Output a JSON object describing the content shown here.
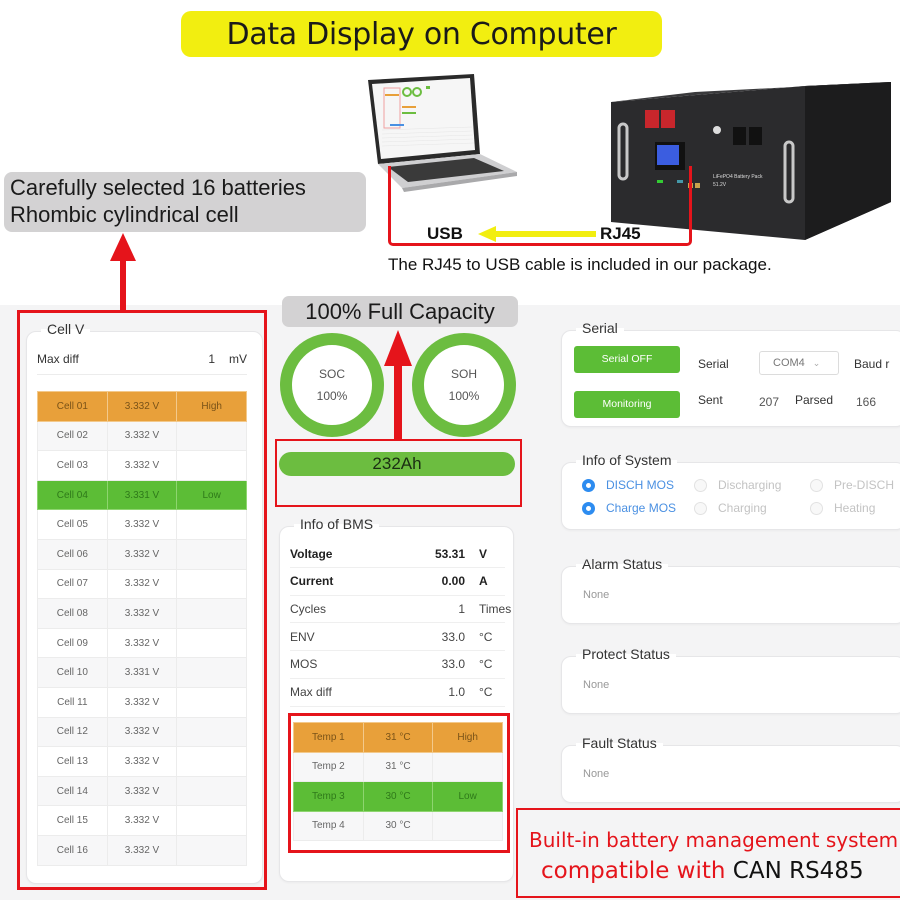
{
  "header": {
    "title": "Data Display on Computer",
    "usb_label": "USB",
    "rj45_label": "RJ45",
    "cable_note": "The RJ45 to USB cable is included in our package.",
    "battery_label": "LiFePO4 Battery Pack",
    "battery_voltage": "51.2V"
  },
  "callouts": {
    "cells_line1": "Carefully selected 16 batteries",
    "cells_line2": "Rhombic cylindrical cell",
    "capacity": "100% Full Capacity",
    "bms_line1": "Built-in battery management system",
    "bms_line2_prefix": "compatible with ",
    "bms_line2_highlight": "CAN RS485"
  },
  "cell_v": {
    "legend": "Cell V",
    "max_diff_label": "Max diff",
    "max_diff_value": "1",
    "max_diff_unit": "mV",
    "rows": [
      {
        "name": "Cell 01",
        "voltage": "3.332 V",
        "flag": "High",
        "state": "high"
      },
      {
        "name": "Cell 02",
        "voltage": "3.332 V",
        "flag": "",
        "state": ""
      },
      {
        "name": "Cell 03",
        "voltage": "3.332 V",
        "flag": "",
        "state": ""
      },
      {
        "name": "Cell 04",
        "voltage": "3.331 V",
        "flag": "Low",
        "state": "low"
      },
      {
        "name": "Cell 05",
        "voltage": "3.332 V",
        "flag": "",
        "state": ""
      },
      {
        "name": "Cell 06",
        "voltage": "3.332 V",
        "flag": "",
        "state": ""
      },
      {
        "name": "Cell 07",
        "voltage": "3.332 V",
        "flag": "",
        "state": ""
      },
      {
        "name": "Cell 08",
        "voltage": "3.332 V",
        "flag": "",
        "state": ""
      },
      {
        "name": "Cell 09",
        "voltage": "3.332 V",
        "flag": "",
        "state": ""
      },
      {
        "name": "Cell 10",
        "voltage": "3.331 V",
        "flag": "",
        "state": ""
      },
      {
        "name": "Cell 11",
        "voltage": "3.332 V",
        "flag": "",
        "state": ""
      },
      {
        "name": "Cell 12",
        "voltage": "3.332 V",
        "flag": "",
        "state": ""
      },
      {
        "name": "Cell 13",
        "voltage": "3.332 V",
        "flag": "",
        "state": ""
      },
      {
        "name": "Cell 14",
        "voltage": "3.332 V",
        "flag": "",
        "state": ""
      },
      {
        "name": "Cell 15",
        "voltage": "3.332 V",
        "flag": "",
        "state": ""
      },
      {
        "name": "Cell 16",
        "voltage": "3.332 V",
        "flag": "",
        "state": ""
      }
    ]
  },
  "gauges": {
    "soc_label": "SOC",
    "soc_value": "100%",
    "soh_label": "SOH",
    "soh_value": "100%",
    "capacity": "232Ah"
  },
  "bms": {
    "legend": "Info of BMS",
    "rows": [
      {
        "key": "Voltage",
        "value": "53.31",
        "unit": "V",
        "bold": true
      },
      {
        "key": "Current",
        "value": "0.00",
        "unit": "A",
        "bold": true
      },
      {
        "key": "Cycles",
        "value": "1",
        "unit": "Times",
        "bold": false
      },
      {
        "key": "ENV",
        "value": "33.0",
        "unit": "°C",
        "bold": false
      },
      {
        "key": "MOS",
        "value": "33.0",
        "unit": "°C",
        "bold": false
      },
      {
        "key": "Max diff",
        "value": "1.0",
        "unit": "°C",
        "bold": false
      }
    ],
    "temps": [
      {
        "name": "Temp 1",
        "value": "31 °C",
        "flag": "High",
        "state": "high"
      },
      {
        "name": "Temp 2",
        "value": "31 °C",
        "flag": "",
        "state": ""
      },
      {
        "name": "Temp 3",
        "value": "30 °C",
        "flag": "Low",
        "state": "low"
      },
      {
        "name": "Temp 4",
        "value": "30 °C",
        "flag": "",
        "state": ""
      }
    ]
  },
  "serial": {
    "legend": "Serial",
    "serial_off_button": "Serial OFF",
    "monitoring_button": "Monitoring",
    "serial_label": "Serial",
    "port_selected": "COM4",
    "baud_label": "Baud r",
    "sent_label": "Sent",
    "sent_value": "207",
    "parsed_label": "Parsed",
    "parsed_value": "166"
  },
  "system": {
    "legend": "Info of System",
    "indicators": [
      {
        "label": "DISCH MOS",
        "on": true
      },
      {
        "label": "Discharging",
        "on": false
      },
      {
        "label": "Pre-DISCH",
        "on": false
      },
      {
        "label": "Charge MOS",
        "on": true
      },
      {
        "label": "Charging",
        "on": false
      },
      {
        "label": "Heating",
        "on": false
      }
    ]
  },
  "status": {
    "alarm_legend": "Alarm Status",
    "alarm_value": "None",
    "protect_legend": "Protect Status",
    "protect_value": "None",
    "fault_legend": "Fault Status",
    "fault_value": "None"
  }
}
